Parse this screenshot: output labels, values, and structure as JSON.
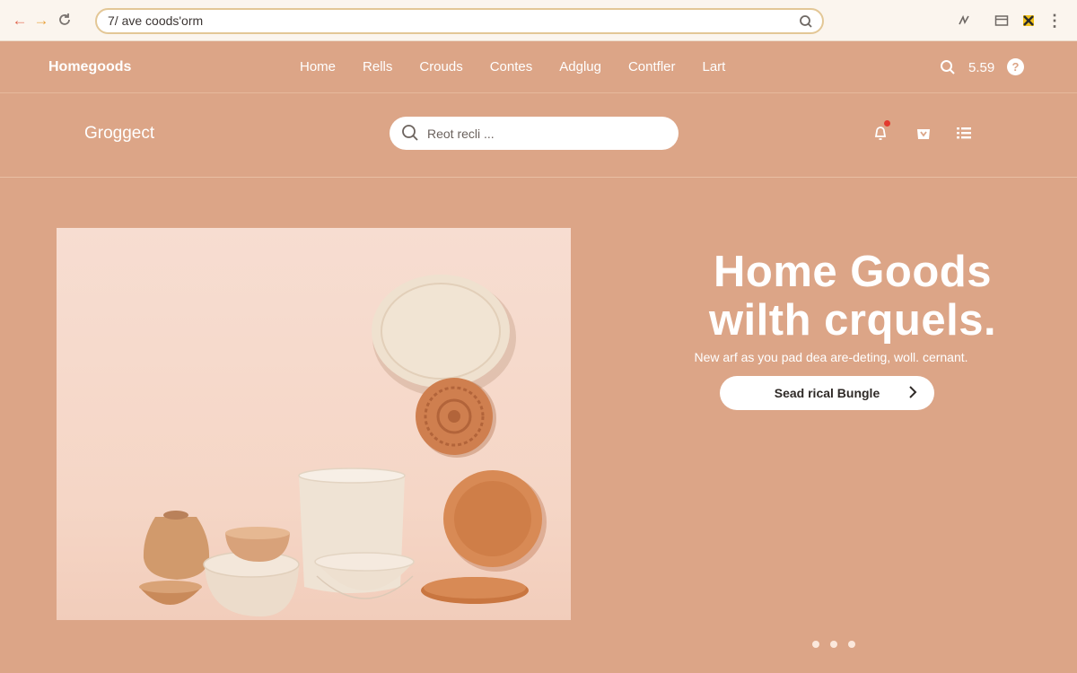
{
  "browser": {
    "url": "7/ ave coods'orm",
    "icons": [
      "back-arrow-icon",
      "forward-arrow-icon",
      "reload-icon",
      "search-icon",
      "extension-icon",
      "tab-icon",
      "puzzle-icon",
      "more-icon"
    ]
  },
  "topnav": {
    "logo": "Homegoods",
    "menu": [
      {
        "label": "Home"
      },
      {
        "label": "Rells"
      },
      {
        "label": "Crouds"
      },
      {
        "label": "Contes"
      },
      {
        "label": "Adglug"
      },
      {
        "label": "Contfler"
      },
      {
        "label": "Lart"
      }
    ],
    "price": "5.59",
    "help": "?"
  },
  "subbar": {
    "brand": "Groggect",
    "search_placeholder": "Reot recli ...",
    "icons": [
      "bell-icon",
      "cart-icon",
      "menu-icon"
    ]
  },
  "hero": {
    "headline_line1": "Home Goods",
    "headline_line2": "wilth crquels.",
    "subhead": "New arf as you pad dea are-deting, woll. cernant.",
    "cta_label": "Sead rical Bungle",
    "slides": 3,
    "active_slide": 1
  },
  "colors": {
    "background": "#dca587",
    "chrome": "#fbf5ee",
    "accent": "#e3c796",
    "cta_text": "#2f2a27"
  }
}
